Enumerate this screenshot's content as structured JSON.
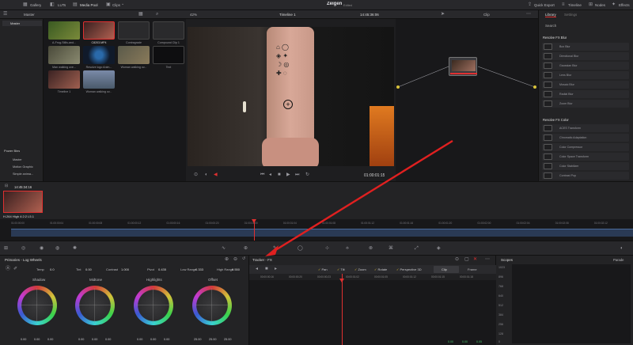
{
  "topbar": {
    "tabs": [
      "Gallery",
      "LUTs",
      "Media Pool",
      "Clips"
    ],
    "project_title": "Zeigen",
    "project_status": "Edited",
    "right_items": [
      "Quick Export",
      "Timeline",
      "Nodes",
      "Effects"
    ]
  },
  "viewer_bar": {
    "zoom": "42%",
    "timeline_name": "Timeline 1",
    "timecode": "14:45:36:06",
    "clip_mode": "Clip"
  },
  "media": {
    "bin_title": "Master",
    "sidebar_master": "Master",
    "clips": [
      {
        "label": "A-Frog-Stills-and...",
        "color": "#4a6a2a"
      },
      {
        "label": "C8203.MP4",
        "color": "#7a3a3a"
      },
      {
        "label": "Contragrade",
        "color": "#2e2e30"
      },
      {
        "label": "Compound Clip 1",
        "color": "#2e2e30"
      },
      {
        "label": "Man walking ove...",
        "color": "#5a5a4a"
      },
      {
        "label": "Resolve logo Anim...",
        "color": "#1a2a3a"
      },
      {
        "label": "Woman walking ov...",
        "color": "#6a6a5a"
      },
      {
        "label": "Text",
        "color": "#111113"
      },
      {
        "label": "Timeline 1",
        "color": "#5a3a3a"
      },
      {
        "label": "Woman walking ov...",
        "color": "#5a6a8a"
      }
    ],
    "power_bins_title": "Power Bins",
    "power_bins": [
      "Master",
      "Motion Graphic",
      "Simple anima..."
    ]
  },
  "clip_info": {
    "timecode": "14:45:34:16",
    "codec": "H.264 High 4:2:2 L5.1"
  },
  "viewer": {
    "timecode": "01:00:01:15"
  },
  "timeline_ruler": [
    "01:00:00:00",
    "01:00:00:04",
    "01:00:00:08",
    "01:00:00:12",
    "01:00:00:16",
    "01:00:00:20",
    "01:00:01:00",
    "01:00:01:04",
    "01:00:01:08",
    "01:00:01:12",
    "01:00:01:16",
    "01:00:01:20",
    "01:00:02:00",
    "01:00:02:04",
    "01:00:02:08",
    "01:00:02:12"
  ],
  "library": {
    "tabs": [
      "Library",
      "Settings"
    ],
    "search": "Search",
    "blur_title": "Resolve FX Blur",
    "blur_items": [
      "Box Blur",
      "Directional Blur",
      "Gaussian Blur",
      "Lens Blur",
      "Mosaic Blur",
      "Radial Blur",
      "Zoom Blur"
    ],
    "color_title": "Resolve FX Color",
    "color_items": [
      "ACES Transform",
      "Chromatic Adaptation",
      "Color Compressor",
      "Color Space Transform",
      "Color Stabilizer",
      "Contrast Pop"
    ]
  },
  "primaries": {
    "title": "Primaries - Log Wheels",
    "params": [
      {
        "label": "Temp",
        "value": "0.0"
      },
      {
        "label": "Tint",
        "value": "0.00"
      },
      {
        "label": "Contrast",
        "value": "1.000"
      },
      {
        "label": "Pivot",
        "value": "0.435"
      },
      {
        "label": "Low Range",
        "value": "0.333"
      },
      {
        "label": "High Range",
        "value": "0.550"
      }
    ],
    "wheels": [
      {
        "label": "Shadow",
        "values": [
          "0.00",
          "0.00",
          "0.00"
        ]
      },
      {
        "label": "Midtone",
        "values": [
          "0.00",
          "0.00",
          "0.00"
        ]
      },
      {
        "label": "Highlights",
        "values": [
          "0.00",
          "0.00",
          "0.00"
        ]
      },
      {
        "label": "Offset",
        "values": [
          "25.00",
          "25.00",
          "25.00"
        ]
      }
    ]
  },
  "tracker": {
    "title": "Tracker - FX",
    "options": [
      "Pan",
      "Tilt",
      "Zoom",
      "Rotate",
      "Perspective 3D"
    ],
    "modes": [
      "Clip",
      "Frame"
    ],
    "ruler": [
      "00:00:00:16",
      "00:00:00:20",
      "00:00:00:23",
      "00:00:01:02",
      "00:00:01:05",
      "00:00:01:12",
      "00:00:01:15",
      "00:00:01:18"
    ],
    "bottom_values": [
      "0.00",
      "0.00",
      "0.05"
    ]
  },
  "scopes": {
    "title": "Scopes",
    "mode": "Parade",
    "scale": [
      "1023",
      "896",
      "768",
      "640",
      "512",
      "384",
      "256",
      "128",
      "0"
    ]
  },
  "colors": {
    "accent_red": "#e03030",
    "accent_orange": "#e07a20",
    "check_yellow": "#e0c23a"
  }
}
